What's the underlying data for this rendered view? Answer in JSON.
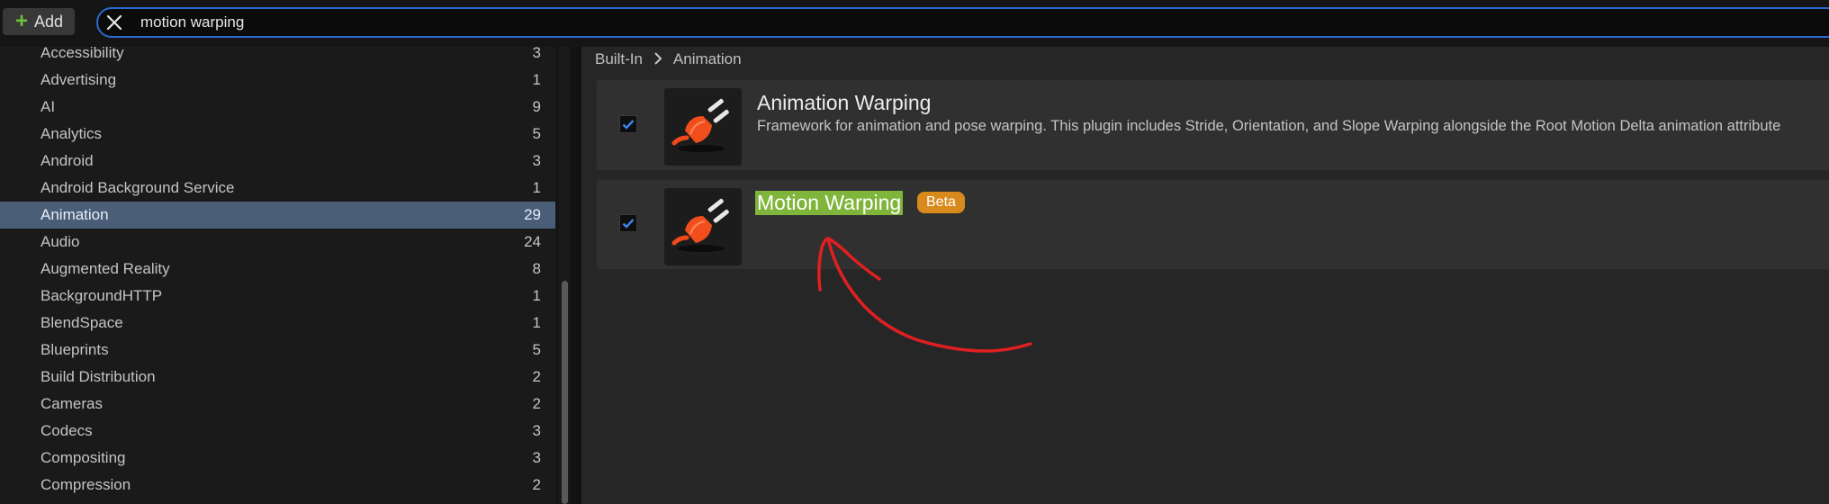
{
  "toolbar": {
    "add_label": "Add"
  },
  "search": {
    "value": "motion warping"
  },
  "categories": [
    {
      "label": "Accessibility",
      "count": "3"
    },
    {
      "label": "Advertising",
      "count": "1"
    },
    {
      "label": "AI",
      "count": "9"
    },
    {
      "label": "Analytics",
      "count": "5"
    },
    {
      "label": "Android",
      "count": "3"
    },
    {
      "label": "Android Background Service",
      "count": "1"
    },
    {
      "label": "Animation",
      "count": "29",
      "selected": true
    },
    {
      "label": "Audio",
      "count": "24"
    },
    {
      "label": "Augmented Reality",
      "count": "8"
    },
    {
      "label": "BackgroundHTTP",
      "count": "1"
    },
    {
      "label": "BlendSpace",
      "count": "1"
    },
    {
      "label": "Blueprints",
      "count": "5"
    },
    {
      "label": "Build Distribution",
      "count": "2"
    },
    {
      "label": "Cameras",
      "count": "2"
    },
    {
      "label": "Codecs",
      "count": "3"
    },
    {
      "label": "Compositing",
      "count": "3"
    },
    {
      "label": "Compression",
      "count": "2"
    }
  ],
  "breadcrumb": {
    "root": "Built-In",
    "current": "Animation"
  },
  "plugins": [
    {
      "name": "Animation Warping",
      "description": "Framework for animation and pose warping. This plugin includes Stride, Orientation, and Slope Warping alongside the Root Motion Delta animation attribute",
      "enabled": true
    },
    {
      "name": "Motion Warping",
      "badge": "Beta",
      "enabled": true
    }
  ],
  "colors": {
    "accent_blue": "#2a6ad0",
    "selection": "#4a5e78",
    "highlight_green": "#7fb53a",
    "beta_orange": "#d98a1c",
    "annotation_red": "#e02020"
  }
}
